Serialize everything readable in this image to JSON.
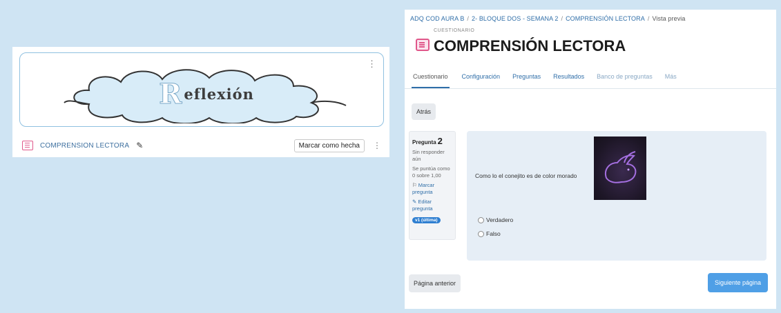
{
  "left": {
    "banner_first_letter": "R",
    "banner_rest": "eflexión",
    "activity_name": "COMPRENSION LECTORA",
    "mark_done_label": "Marcar como hecha"
  },
  "right": {
    "breadcrumb": [
      "ADQ COD AURA B",
      "2- BLOQUE DOS - SEMANA 2",
      "COMPRENSIÓN LECTORA",
      "Vista previa"
    ],
    "module_label": "CUESTIONARIO",
    "page_title": "COMPRENSIÓN LECTORA",
    "tabs": [
      "Cuestionario",
      "Configuración",
      "Preguntas",
      "Resultados",
      "Banco de preguntas",
      "Más"
    ],
    "back_label": "Atrás",
    "question": {
      "label": "Pregunta",
      "number": "2",
      "status": "Sin responder aún",
      "score": "Se puntúa como 0 sobre 1,00",
      "flag_label": "Marcar pregunta",
      "edit_label": "Editar pregunta",
      "badge": "v1 (última)",
      "text": "Como lo el conejito es de color morado",
      "options": [
        "Verdadero",
        "Falso"
      ]
    },
    "prev_label": "Página anterior",
    "next_label": "Siguiente página"
  },
  "colors": {
    "accent": "#2f6ea8",
    "quiz_icon": "#e0578a",
    "next_button": "#4f9fe6",
    "background": "#cfe4f3"
  }
}
